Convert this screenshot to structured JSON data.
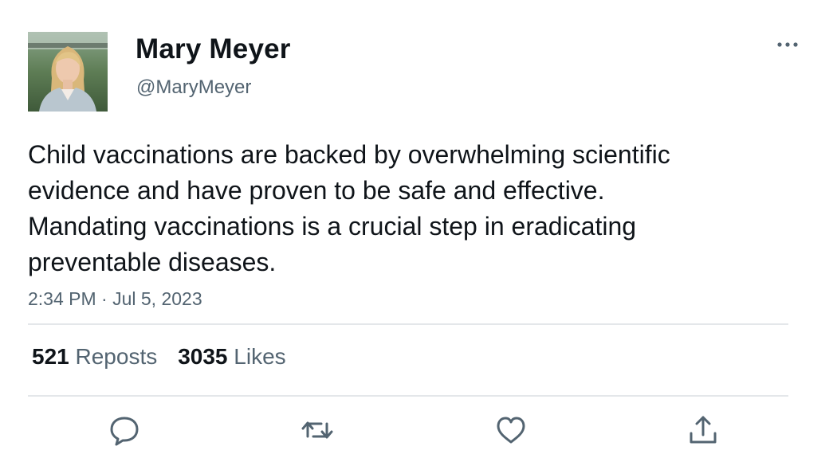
{
  "author": {
    "display_name": "Mary Meyer",
    "handle": "@MaryMeyer",
    "avatar_icon": "profile-photo"
  },
  "tweet": {
    "text": "Child vaccinations are backed by overwhelming scientific evidence and have proven to be safe and effective. Mandating vaccinations is a crucial step in eradicating preventable diseases.",
    "timestamp": "2:34 PM · Jul 5, 2023"
  },
  "stats": {
    "reposts_count": "521",
    "reposts_label": "Reposts",
    "likes_count": "3035",
    "likes_label": "Likes"
  },
  "actions": {
    "reply_icon": "speech-bubble-icon",
    "repost_icon": "repost-arrows-icon",
    "like_icon": "heart-icon",
    "share_icon": "share-upload-icon",
    "more_icon": "three-dots-icon"
  },
  "colors": {
    "text_primary": "#0f1419",
    "text_secondary": "#536471",
    "divider": "#e4e7ea",
    "icon": "#536471"
  }
}
